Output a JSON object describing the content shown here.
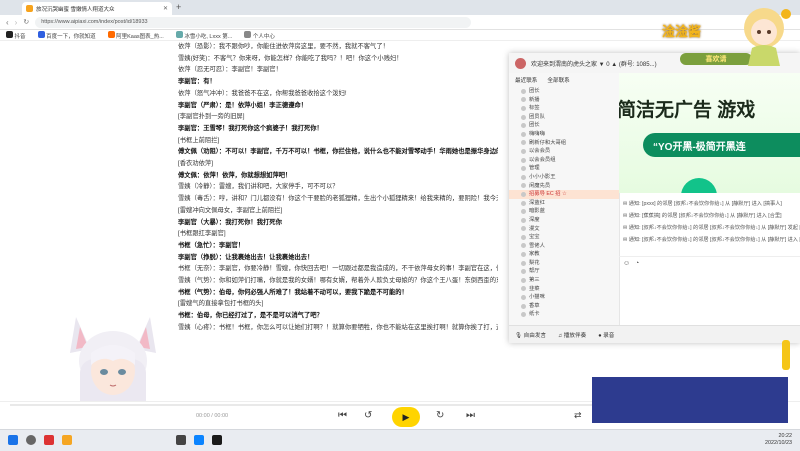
{
  "browser": {
    "tab_title": "旅况沉哭幽蜜 雪嫩情人翔道大众",
    "url": "https://www.aipiaxi.com/index/post/id/18933",
    "bookmarks": [
      "抖音",
      "百度一下，你就知道",
      "阿里Kaas图表_热...",
      "冰雪小吃, Lxxx 第...",
      "个人中心"
    ]
  },
  "script_lines": [
    {
      "text": "依萍（恐影）：我不跟你吵，你能住进依萍房这里，要不然，我就不客气了！",
      "bold": false
    },
    {
      "text": "雪姨(好笑)：不客气？你来呀，你能怎样？你能吃了我吗？！吧！你这个小贱妇！",
      "bold": false
    },
    {
      "text": "依萍（忍无可忍）：李副官！李副官！",
      "bold": false
    },
    {
      "text": "李副官：有！",
      "bold": true
    },
    {
      "text": "依萍（怒气冲冲）：我爸爸不在这，你帮我爸爸收拾这个泼妇!",
      "bold": false
    },
    {
      "text": "李副官（严肃）：是！依萍小姐！李正德遵命！",
      "bold": true
    },
    {
      "text": "[李副官扑到一旁的旧屏]",
      "bold": false
    },
    {
      "text": "李副官：王雪琴！我打死你这个疯婆子！我打死你！",
      "bold": true
    },
    {
      "text": "[书框上前阻拦]",
      "bold": false
    },
    {
      "text": "傅文佩（劝阻）：不可以！李副官，千万不可以！书框，你拦住他，说什么也不能对雪琴动手！华雨她也是振华身边的人啊！",
      "bold": true
    },
    {
      "text": "[香衣劝依萍]",
      "bold": false
    },
    {
      "text": "傅文佩：依萍！依萍，你就想想如萍吧！",
      "bold": true
    },
    {
      "text": "雪姨（冷静）：雷嫂，我们讲和吧，大家停手，可不可以？",
      "bold": false
    },
    {
      "text": "雪姨（毒舌）：哼，讲和？门儿都没有！你这个干要脸的老狐狸精，生出个小狐狸精来！给我来精的，要阴险！我今天要撕碎你这张脸！",
      "bold": false
    },
    {
      "text": "[雷嫂冲向文佩母女，李副官上前阻拦]",
      "bold": false
    },
    {
      "text": "李副官（大暴）：我打死你！我打死你",
      "bold": true
    },
    {
      "text": "[书框跟扛李副官]",
      "bold": false
    },
    {
      "text": "书框（急忙）：李副官！",
      "bold": true
    },
    {
      "text": "李副官（挣脱）：让我裹她出去！让我裹她出去！",
      "bold": true
    },
    {
      "text": "书框（无奈）：李副官，你要冷静！雪嫂，你快回去吧！一切跟过都是我造成的，不干依萍母女的事！李副官在这，你也占下到好处！还是回去，平平静静的停一停，不要弄得大家都下不来台！找他们的感觉，你还是要睡在的，不是吗？！反正下错万错都是我错！你有气冲着我一个人来！",
      "bold": false
    },
    {
      "text": "雪姨（气势）：你和如萍们打嘴，你就是我的女婿！哪有女婿，帮着外人欺负丈母娘的？你这个王八蛋！东倒西歪的东西！你让我有气出在你一个人身上是吧？那好，有种的，你就站着别动！不要像上一次那样，躲在如萍的裙子底下，你算什么好汉！好啊，你要帮他们支撑是吧？那你就给我跪下！",
      "bold": false
    },
    {
      "text": "书框（气势）：伯母，你何必强人所难了！我站着不动可以，要我下跪是不可能的！",
      "bold": true
    },
    {
      "text": "[雷嫂气的直接拿包打书框的头]",
      "bold": false
    },
    {
      "text": "书框：伯母，你已经打过了，是不是可以消气了吧？",
      "bold": true
    },
    {
      "text": "雪姨（心疼）：书框！书框，你怎么可以让她们打啊？！就算你要牺牲，你也不能站在这里挨打啊！就算你挨了打，这个疯女人也不会放过我们的！",
      "bold": false
    }
  ],
  "player": {
    "time": "00:00 / 00:00"
  },
  "chat": {
    "title": "欢迎来到渭南的虎头之家 ▼ 0 ▲ (群号: 1085...)",
    "tabs": [
      "最近联系",
      "全部联系"
    ],
    "categories": [
      "团长",
      "新播",
      "标签",
      "团员队",
      "团长",
      "嗨嗨嗨",
      "刷新仔和大哥组",
      "以会会员",
      "以会会员组",
      "管理",
      "小小小影王",
      "闲魔先员",
      "招募导 EC 招 ☆",
      "深蓝红",
      "暗影蓝",
      "深度",
      "漫文",
      "宝宝",
      "雪佬人",
      "家教",
      "梨花",
      "帮厅",
      "第三",
      "韭菜",
      "小猫咪",
      "香草",
      "纸卡"
    ],
    "selected_index": 12,
    "banner_title": "简洁无广告  游戏",
    "banner_pill": "“YO开黑-极简开黑连",
    "messages": [
      "✉ 通知: [pxxx] 的邻居 [叔邦↓不会饮你你给↓] 从 [静默厅] 进入 [搞事人]",
      "✉ 通知: [蕉蕉搞] 的邻居 [叔邦↓不会饮你你给↓] 从 [静默厅] 进入 [合里]",
      "✉ 通知: [叔邦↓不会饮你你给↓] 的邻居 [叔邦↓不会饮你你给↓] 从 [静默厅] 发起 [合里]",
      "✉ 通知: [叔邦↓不会饮你你给↓] 的邻居 [叔邦↓不会饮你你给↓] 从 [静默厅] 进入 [静默]"
    ],
    "footer_items": [
      "自由发言",
      "播放伴奏",
      "录音"
    ]
  },
  "overlay": {
    "brand": "淦淦酱",
    "sub": "喜欢请"
  },
  "taskbar": {
    "time": "20:22",
    "date": "2022/10/23"
  }
}
